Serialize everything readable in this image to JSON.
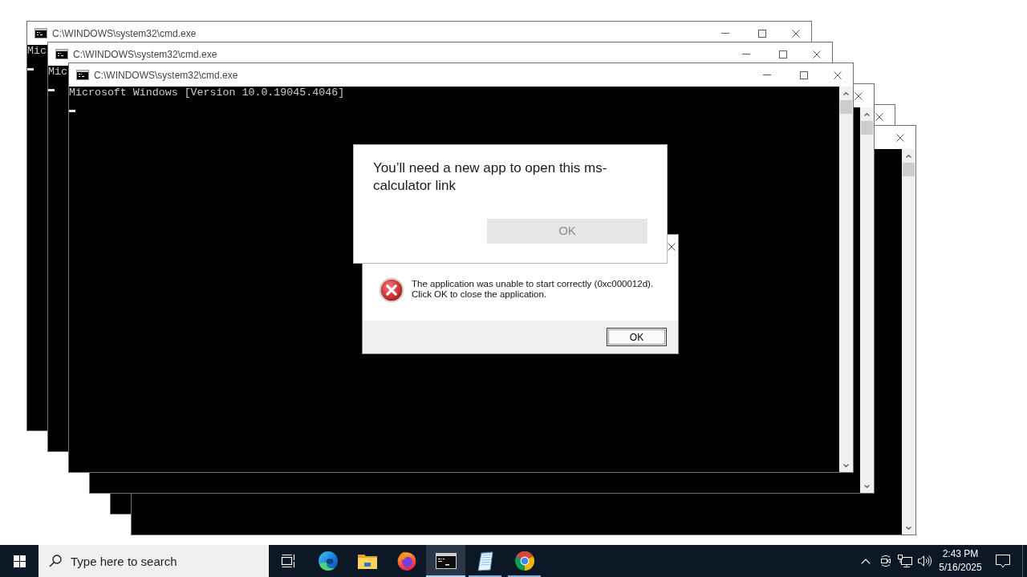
{
  "desktop": {
    "windows": [
      {
        "title": "C:\\WINDOWS\\system32\\cmd.exe",
        "controls": [
          {
            "kind": "minimize"
          },
          {
            "kind": "maximize"
          },
          {
            "kind": "close"
          }
        ],
        "lines": [
          "Mic"
        ],
        "cursor": true
      },
      {
        "title": "C:\\WINDOWS\\system32\\cmd.exe",
        "controls": [
          {
            "kind": "minimize"
          },
          {
            "kind": "maximize"
          },
          {
            "kind": "close"
          }
        ],
        "lines": [
          "Mic"
        ],
        "cursor": true
      },
      {
        "title": "C:\\WINDOWS\\system32\\cmd.exe",
        "controls": [
          {
            "kind": "minimize"
          },
          {
            "kind": "maximize"
          },
          {
            "kind": "close"
          }
        ],
        "lines": [
          "Microsoft Windows [Version 10.0.19045.4046]"
        ],
        "cursor": true,
        "scrollbar": true
      },
      {
        "controls": [
          {
            "kind": "close"
          }
        ],
        "scrollbar": true
      },
      {
        "controls": [
          {
            "kind": "close"
          }
        ]
      },
      {
        "controls": [
          {
            "kind": "close"
          }
        ],
        "scrollbar": true
      }
    ]
  },
  "app_prompt": {
    "message": "You’ll need a new app to open this ms-calculator link",
    "button": "OK"
  },
  "error_dialog": {
    "controls": [
      {
        "kind": "close"
      }
    ],
    "message_lines": [
      "The application was unable to start correctly (0xc000012d).",
      "Click OK to close the application."
    ],
    "button": "OK"
  },
  "taskbar": {
    "search": {
      "placeholder": "Type here to search"
    },
    "apps": [
      {
        "kind": "edge",
        "running": false,
        "selected": false
      },
      {
        "kind": "folder",
        "running": false,
        "selected": false
      },
      {
        "kind": "firefox",
        "running": false,
        "selected": false
      },
      {
        "kind": "terminal",
        "running": true,
        "selected": true
      },
      {
        "kind": "notepad",
        "running": true,
        "selected": false
      },
      {
        "kind": "chrome",
        "running": true,
        "selected": false
      }
    ],
    "clock": {
      "time": "2:43 PM",
      "date": "5/16/2025"
    }
  }
}
